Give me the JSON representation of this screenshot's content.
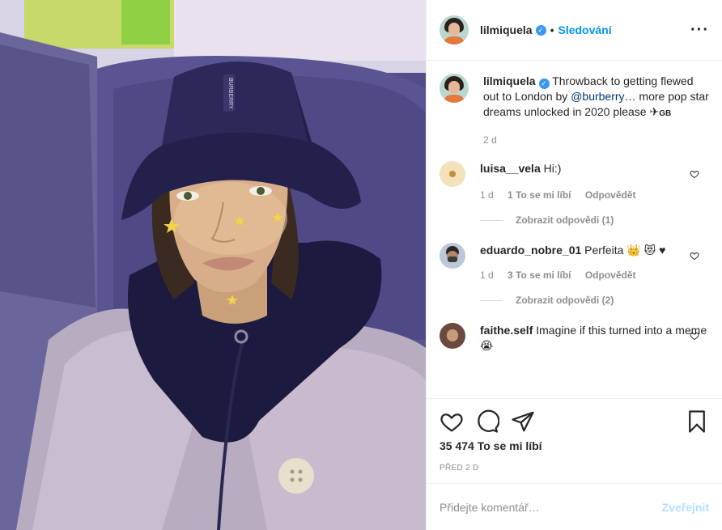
{
  "header": {
    "username": "lilmiquela",
    "separator": "•",
    "follow_label": "Sledování",
    "more_icon": "more-horizontal-icon"
  },
  "caption": {
    "username": "lilmiquela",
    "text_before": "Throwback to getting flewed out to London by ",
    "mention": "@burberry",
    "text_after": "… more pop star dreams unlocked in 2020 please ✈",
    "flag": "GB",
    "age": "2 d"
  },
  "comments": [
    {
      "username": "luisa__vela",
      "text": "Hi:)",
      "age": "1 d",
      "likes": "1 To se mi líbí",
      "reply": "Odpovědět",
      "view_replies": "Zobrazit odpovědi (1)"
    },
    {
      "username": "eduardo_nobre_01",
      "text": "Perfeita 👑 😻 ♥",
      "age": "1 d",
      "likes": "3 To se mi líbí",
      "reply": "Odpovědět",
      "view_replies": "Zobrazit odpovědi (2)"
    },
    {
      "username": "faithe.self",
      "text": "Imagine if this turned into a meme 😭"
    }
  ],
  "actions": {
    "likes": "35 474 To se mi líbí",
    "date": "PŘED 2 D"
  },
  "add_comment": {
    "placeholder": "Přidejte komentář…",
    "publish_label": "Zveřejnit"
  },
  "colors": {
    "link_blue": "#0095f6",
    "verified_blue": "#3897f0",
    "muted_gray": "#8e8e8e"
  }
}
